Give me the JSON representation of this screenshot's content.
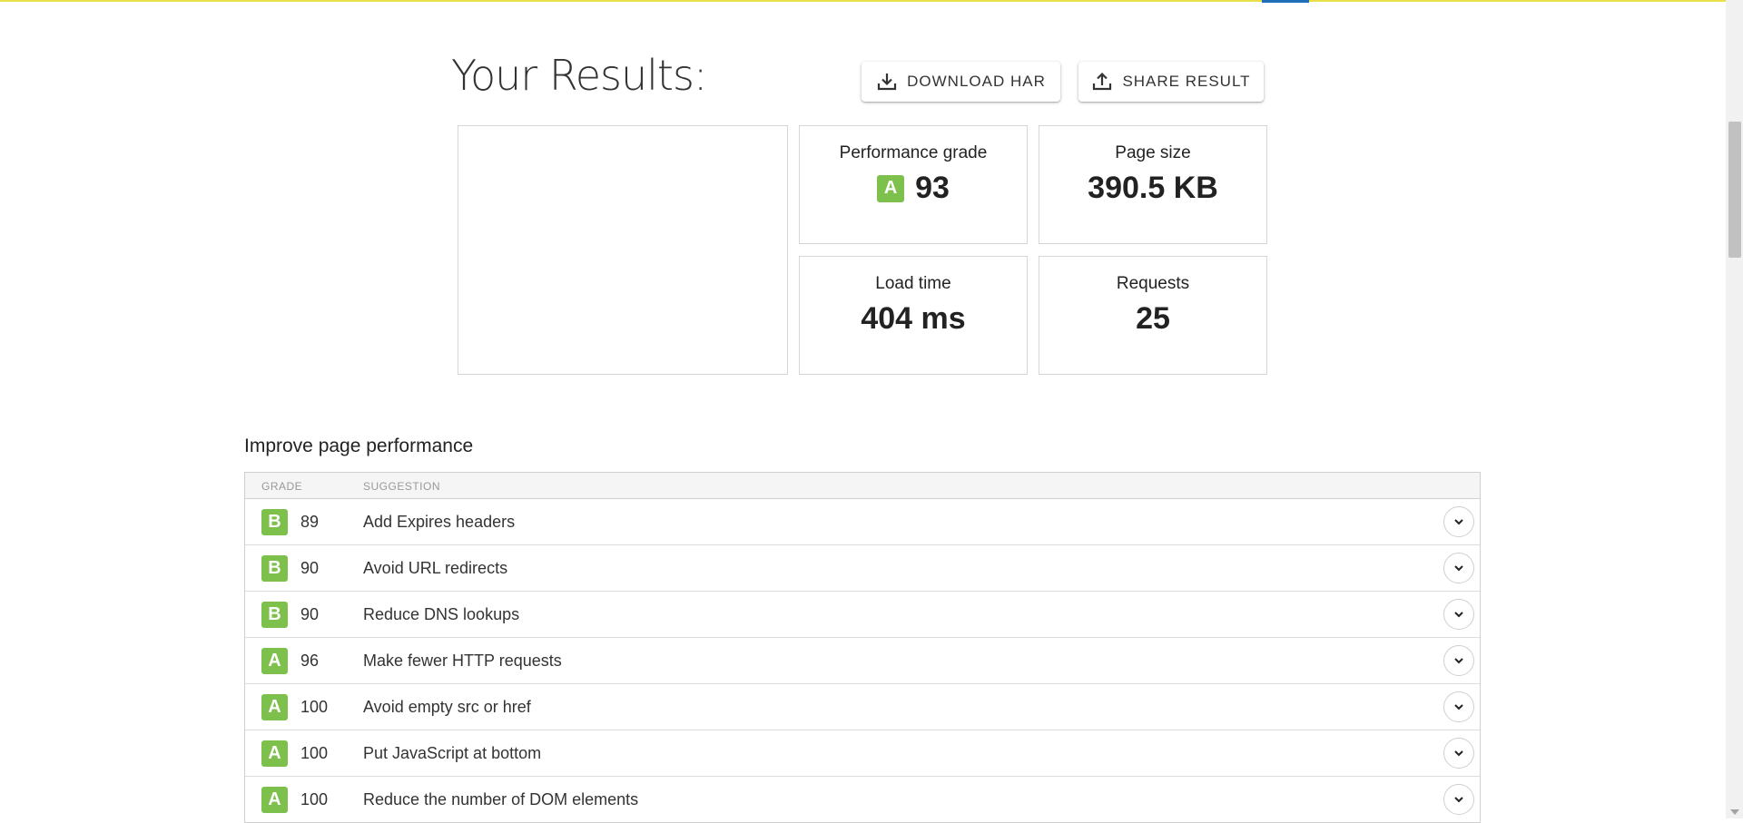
{
  "header": {
    "title": "Your Results:",
    "download_label": "DOWNLOAD HAR",
    "share_label": "SHARE RESULT"
  },
  "stats": {
    "grade": {
      "label": "Performance grade",
      "letter": "A",
      "value": "93"
    },
    "page_size": {
      "label": "Page size",
      "value": "390.5 KB"
    },
    "load_time": {
      "label": "Load time",
      "value": "404 ms"
    },
    "requests": {
      "label": "Requests",
      "value": "25"
    }
  },
  "improve": {
    "title": "Improve page performance",
    "columns": {
      "grade": "GRADE",
      "suggestion": "SUGGESTION"
    },
    "rows": [
      {
        "letter": "B",
        "score": "89",
        "suggestion": "Add Expires headers"
      },
      {
        "letter": "B",
        "score": "90",
        "suggestion": "Avoid URL redirects"
      },
      {
        "letter": "B",
        "score": "90",
        "suggestion": "Reduce DNS lookups"
      },
      {
        "letter": "A",
        "score": "96",
        "suggestion": "Make fewer HTTP requests"
      },
      {
        "letter": "A",
        "score": "100",
        "suggestion": "Avoid empty src or href"
      },
      {
        "letter": "A",
        "score": "100",
        "suggestion": "Put JavaScript at bottom"
      },
      {
        "letter": "A",
        "score": "100",
        "suggestion": "Reduce the number of DOM elements"
      }
    ]
  },
  "colors": {
    "grade_green": "#7dc04b",
    "top_accent": "#e8e04a"
  },
  "icons": {
    "download": "download-icon",
    "share": "share-icon",
    "expand": "chevron-down-icon"
  }
}
